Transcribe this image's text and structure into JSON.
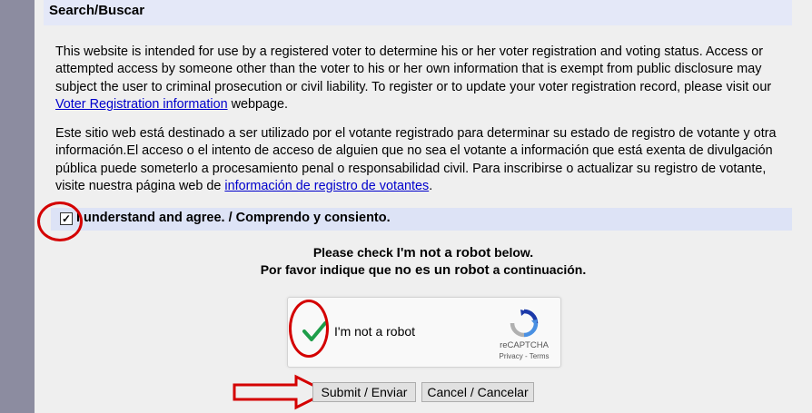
{
  "header": {
    "title": "Search/Buscar"
  },
  "notice_en": {
    "text": "This website is intended for use by a registered voter to determine his or her voter registration and voting status. Access or attempted access by someone other than the voter to his or her own information that is exempt from public disclosure may subject the user to criminal prosecution or civil liability. To register or to update your voter registration record, please visit our ",
    "link": "Voter Registration information",
    "suffix": " webpage."
  },
  "notice_es": {
    "text": "Este sitio web está destinado a ser utilizado por el votante registrado para determinar su estado de registro de votante y otra información.El acceso o el intento de acceso de alguien que no sea el votante a información que está exenta de divulgación pública puede someterlo a procesamiento penal o responsabilidad civil. Para inscribirse o actualizar su registro de votante, visite nuestra página web de ",
    "link": "información de registro de votantes",
    "suffix": "."
  },
  "agree": {
    "label": "I understand and agree. / Comprendo y consiento.",
    "checked": true,
    "check_glyph": "✓"
  },
  "instructions": {
    "line1_prefix": "Please check ",
    "line1_emph": "I'm not a robot",
    "line1_suffix": " below.",
    "line2_prefix": "Por favor indique que ",
    "line2_emph": "no es un robot",
    "line2_suffix": " a continuación."
  },
  "captcha": {
    "label": "I'm not a robot",
    "checked": true,
    "brand": "reCAPTCHA",
    "links": "Privacy - Terms"
  },
  "buttons": {
    "submit": "Submit / Enviar",
    "cancel": "Cancel / Cancelar"
  },
  "colors": {
    "annotation_red": "#d40000",
    "link_blue": "#0000cc",
    "check_green": "#1e9e4a",
    "captcha_blue": "#4a90e2"
  },
  "icons": {
    "annotation": [
      "red-circle-annotation",
      "red-arrow-annotation"
    ],
    "captcha_logo": "recaptcha-logo-icon"
  }
}
